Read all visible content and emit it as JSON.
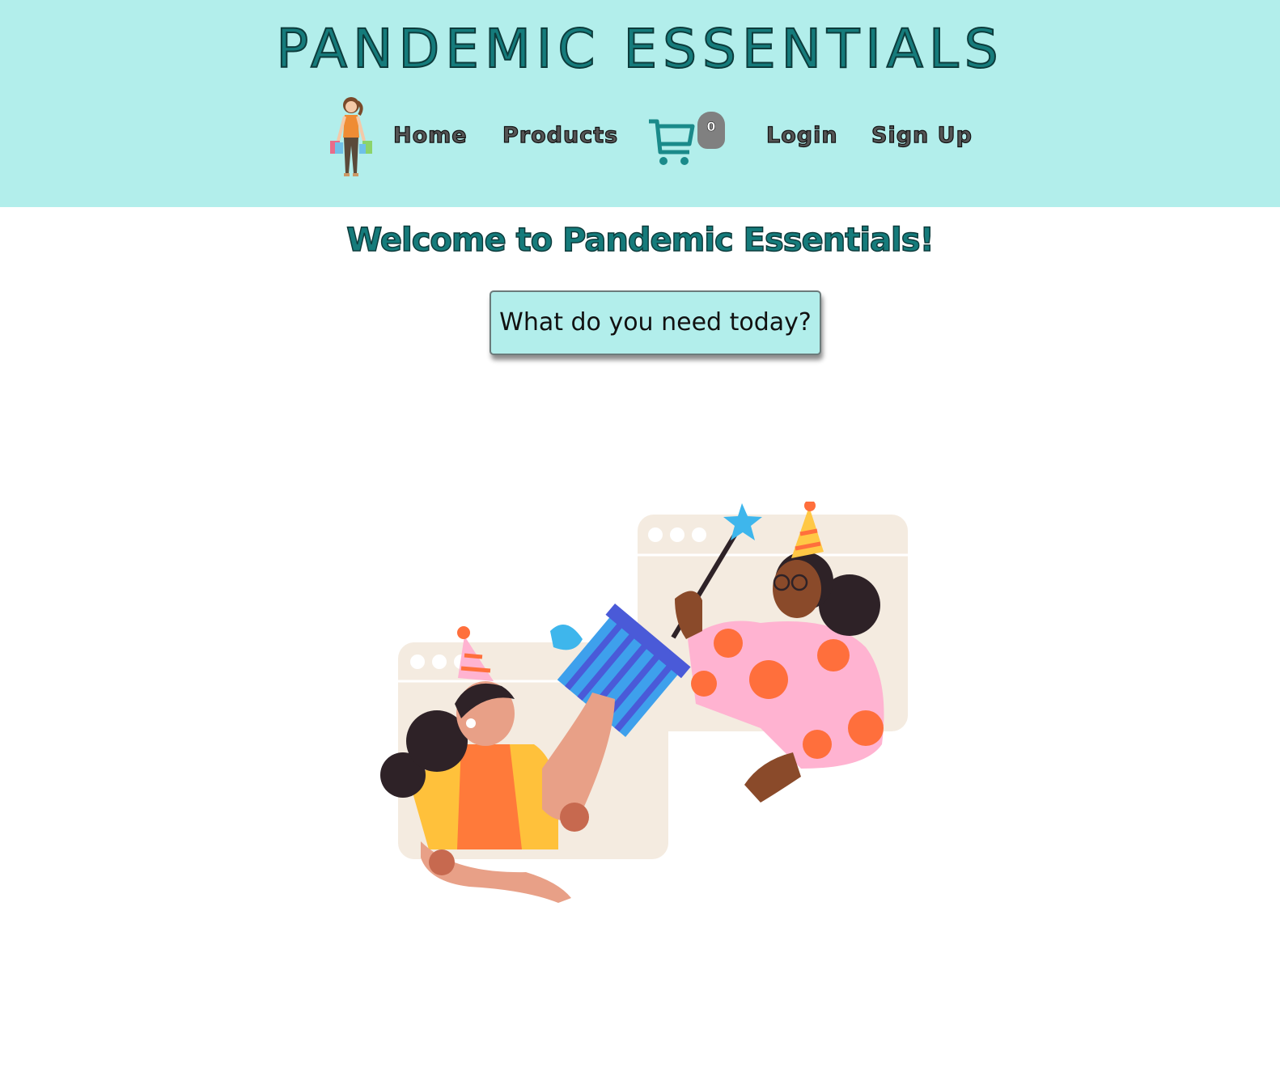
{
  "header": {
    "brand": "PANDEMIC ESSENTIALS",
    "logo_icon": "shopping-woman-icon",
    "nav": {
      "home": "Home",
      "products": "Products",
      "login": "Login",
      "signup": "Sign Up"
    },
    "cart": {
      "icon": "cart-icon",
      "count": "0"
    }
  },
  "main": {
    "welcome": "Welcome to Pandemic Essentials!",
    "cta_label": "What do you need today?",
    "illustration_icon": "video-call-party-illustration"
  },
  "colors": {
    "header_bg": "#b2eeeb",
    "brand_teal": "#157b7b",
    "badge_gray": "#808080"
  }
}
